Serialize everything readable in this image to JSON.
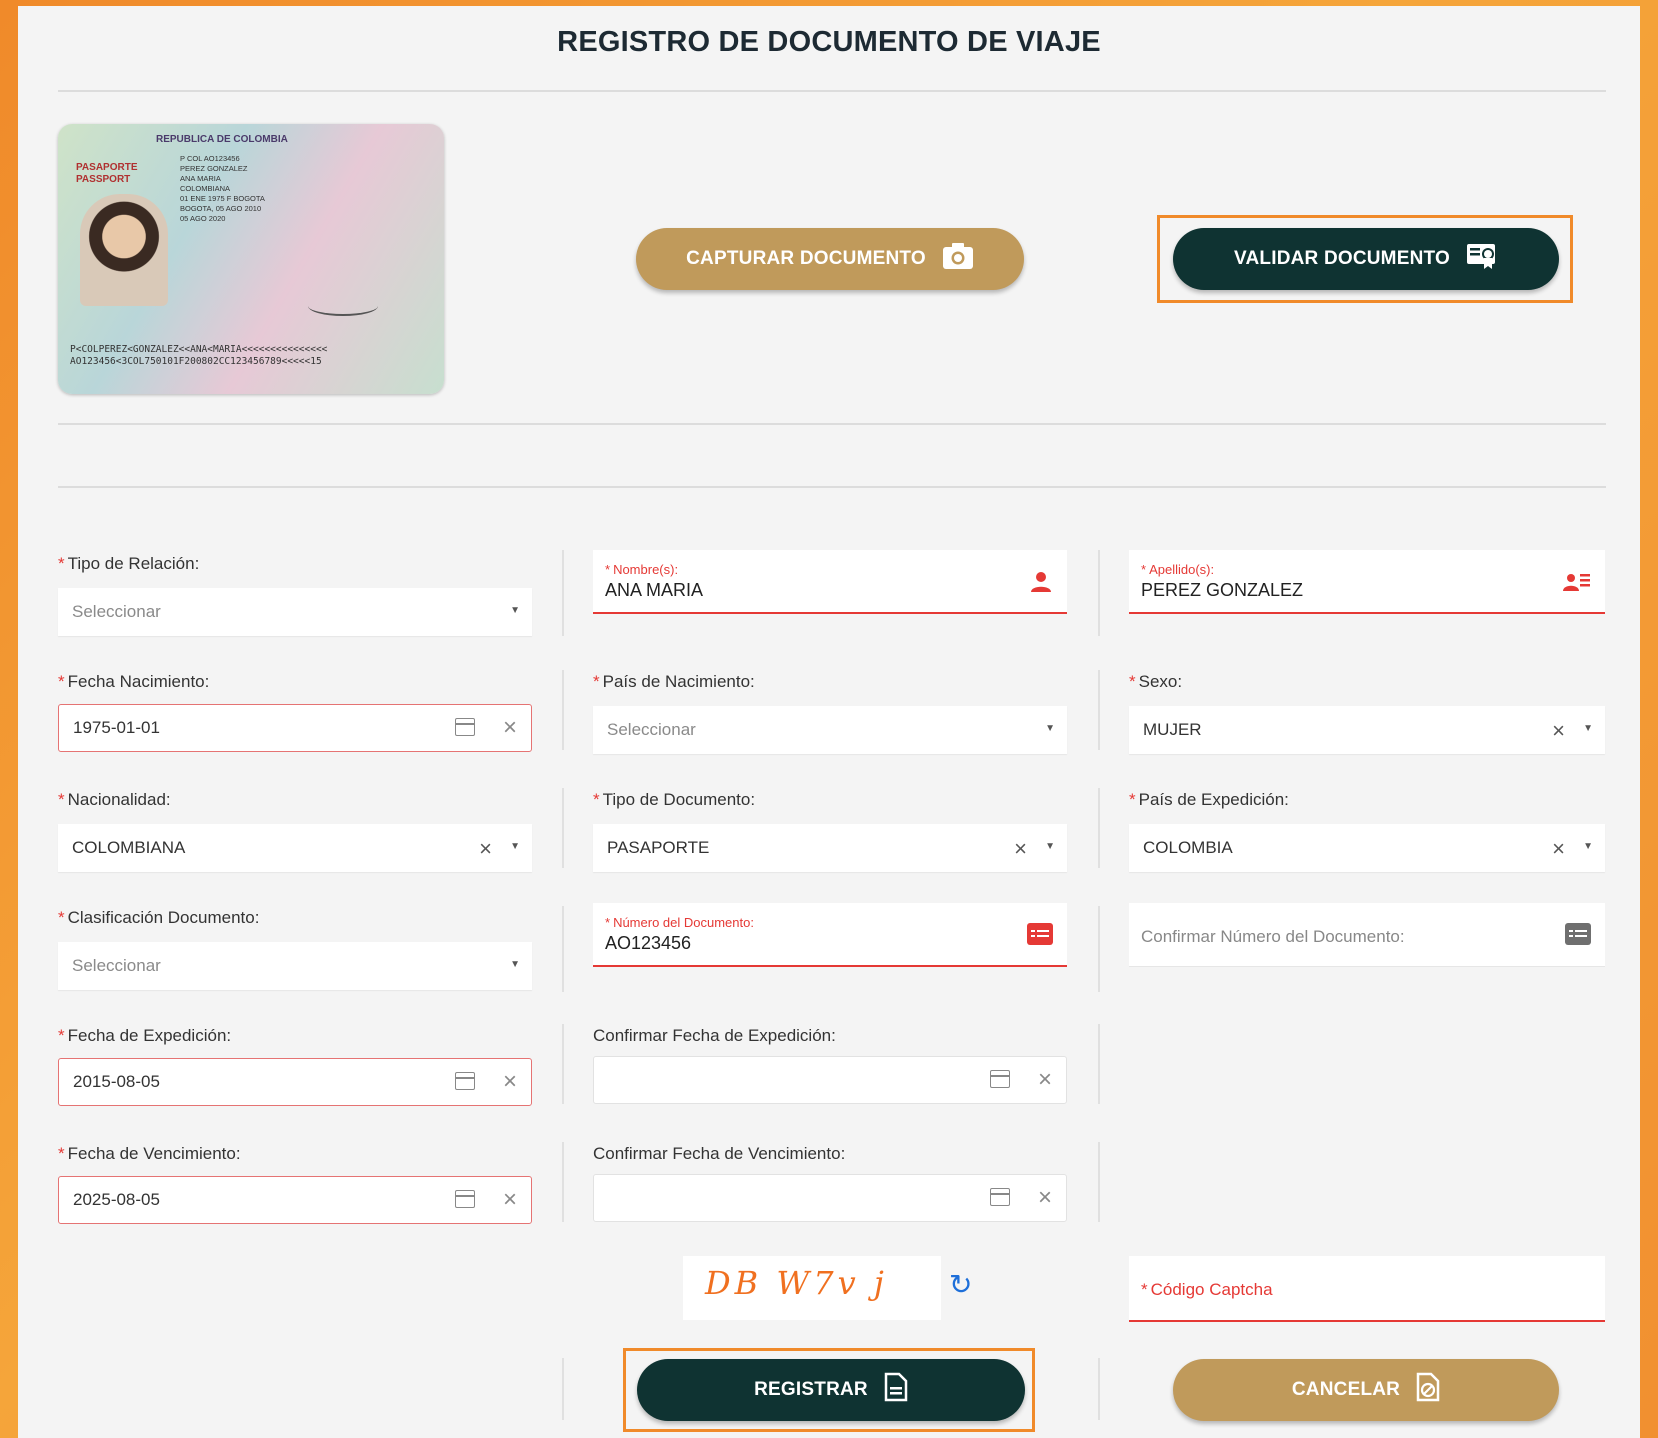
{
  "page": {
    "title": "REGISTRO DE DOCUMENTO DE VIAJE"
  },
  "passport": {
    "country": "REPUBLICA DE COLOMBIA",
    "label": "PASAPORTE PASSPORT",
    "details": "P  COL  AO123456\nPEREZ GONZALEZ\nANA MARIA\nCOLOMBIANA\n01 ENE 1975   F   BOGOTA\nBOGOTA, 05 AGO 2010\n05 AGO 2020",
    "mrz_line1": "P<COLPEREZ<GONZALEZ<<ANA<MARIA<<<<<<<<<<<<<<<",
    "mrz_line2": "AO123456<3COL750101F200802CC123456789<<<<<15"
  },
  "buttons": {
    "capture": "CAPTURAR DOCUMENTO",
    "validate": "VALIDAR DOCUMENTO",
    "register": "REGISTRAR",
    "cancel": "CANCELAR"
  },
  "form": {
    "tipo_relacion": {
      "label": "Tipo de Relación:",
      "placeholder": "Seleccionar"
    },
    "nombres": {
      "label": "Nombre(s):",
      "value": "ANA MARIA"
    },
    "apellidos": {
      "label": "Apellido(s):",
      "value": "PEREZ GONZALEZ"
    },
    "fecha_nacimiento": {
      "label": "Fecha Nacimiento:",
      "value": "1975-01-01"
    },
    "pais_nacimiento": {
      "label": "País de Nacimiento:",
      "placeholder": "Seleccionar"
    },
    "sexo": {
      "label": "Sexo:",
      "value": "MUJER"
    },
    "nacionalidad": {
      "label": "Nacionalidad:",
      "value": "COLOMBIANA"
    },
    "tipo_documento": {
      "label": "Tipo de Documento:",
      "value": "PASAPORTE"
    },
    "pais_expedicion": {
      "label": "País de Expedición:",
      "value": "COLOMBIA"
    },
    "clasificacion": {
      "label": "Clasificación Documento:",
      "placeholder": "Seleccionar"
    },
    "numero_documento": {
      "label": "Número del Documento:",
      "value": "AO123456"
    },
    "confirmar_numero": {
      "placeholder": "Confirmar Número del Documento:"
    },
    "fecha_expedicion": {
      "label": "Fecha de Expedición:",
      "value": "2015-08-05"
    },
    "confirmar_fecha_expedicion": {
      "label": "Confirmar Fecha de Expedición:",
      "value": ""
    },
    "fecha_vencimiento": {
      "label": "Fecha de Vencimiento:",
      "value": "2025-08-05"
    },
    "confirmar_fecha_vencimiento": {
      "label": "Confirmar Fecha de Vencimiento:",
      "value": ""
    },
    "captcha": {
      "image_text": "DB W7v j",
      "label": "Código Captcha"
    }
  },
  "icons": {
    "capture": "camera-icon",
    "validate": "certificate-icon",
    "register": "document-icon",
    "cancel": "document-cancel-icon",
    "refresh": "refresh-icon"
  },
  "colors": {
    "accent_gold": "#c09a5b",
    "dark_green": "#0f3332",
    "required_red": "#e53935",
    "highlight_orange": "#f08a2a",
    "captcha_orange": "#f07020"
  }
}
